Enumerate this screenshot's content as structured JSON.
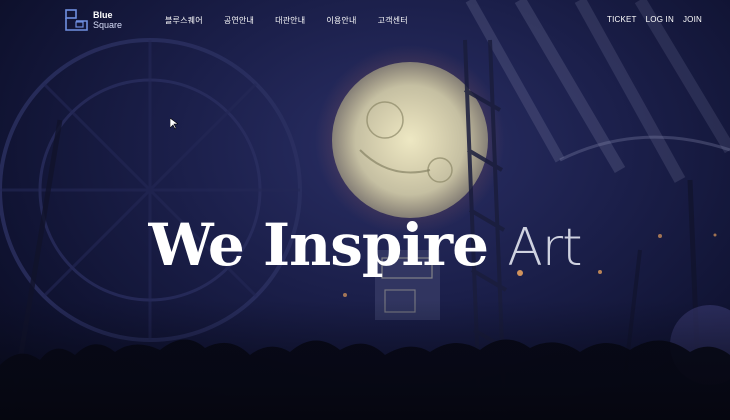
{
  "brand": {
    "name_line1": "Blue",
    "name_line2": "Square",
    "logo_icon": "blue-square-logo-icon"
  },
  "nav": {
    "items": [
      {
        "label": "블루스퀘어"
      },
      {
        "label": "공연안내"
      },
      {
        "label": "대관안내"
      },
      {
        "label": "이용안내"
      },
      {
        "label": "고객센터"
      }
    ]
  },
  "util_nav": {
    "ticket": "TICKET",
    "login": "LOG IN",
    "join": "JOIN"
  },
  "hero": {
    "word1": "We Inspire",
    "word2": "Art"
  },
  "colors": {
    "background": "#151a3d",
    "moon": "#e8e6c0",
    "accent": "#4a90d9"
  }
}
